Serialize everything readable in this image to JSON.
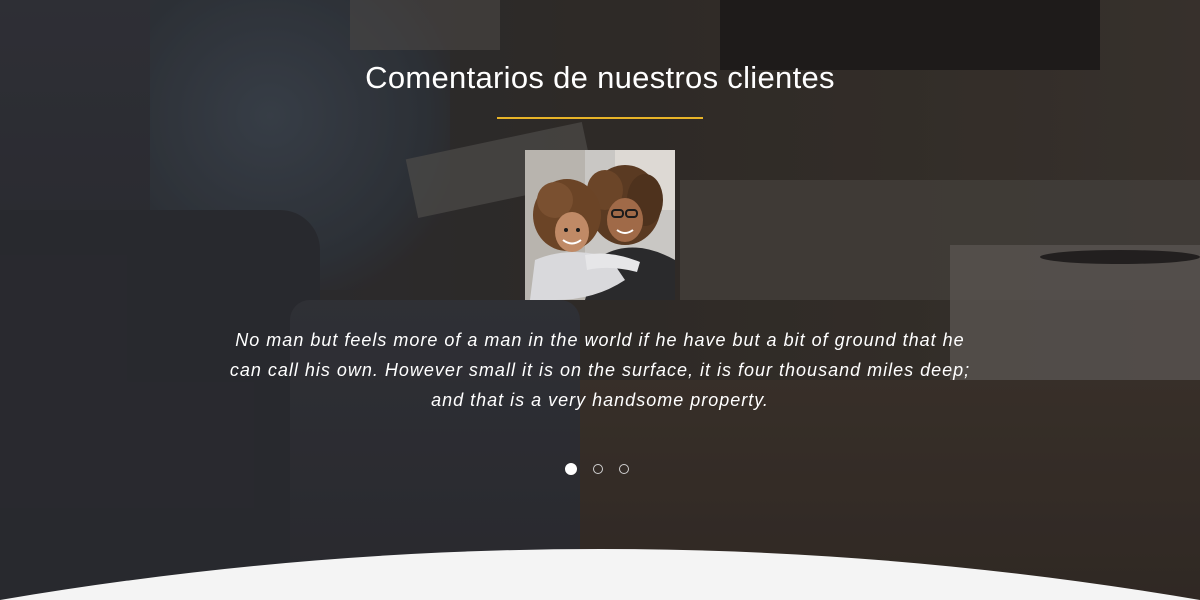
{
  "testimonials": {
    "title": "Comentarios de nuestros clientes",
    "avatar_icon": "customer-photo-mother-and-child",
    "quote": "No man but feels more of a man in the world if he have but a bit of ground that he can call his own. However small it is on the surface, it is four thousand miles deep; and that is a very handsome property.",
    "slides_total": 3,
    "active_slide": 1
  },
  "colors": {
    "accent": "#e8b428",
    "text": "#ffffff",
    "wave": "#f4f4f4"
  }
}
